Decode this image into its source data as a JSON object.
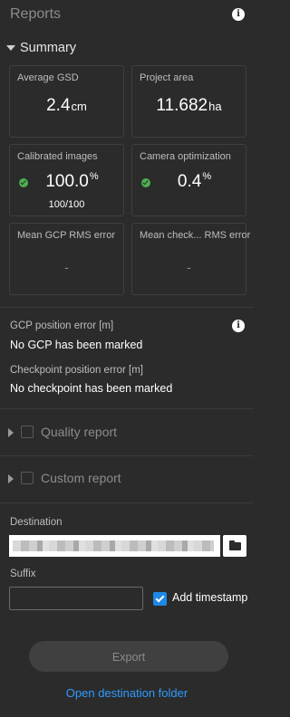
{
  "header": {
    "title": "Reports"
  },
  "summary": {
    "label": "Summary",
    "cards": [
      {
        "label": "Average GSD",
        "value": "2.4",
        "unit": "cm"
      },
      {
        "label": "Project area",
        "value": "11.682",
        "unit": "ha"
      },
      {
        "label": "Calibrated images",
        "value": "100.0",
        "unit": "%",
        "sub": "100/100",
        "status": "ok"
      },
      {
        "label": "Camera optimization",
        "value": "0.4",
        "unit": "%",
        "status": "ok"
      },
      {
        "label": "Mean GCP RMS error",
        "value": "-"
      },
      {
        "label": "Mean check... RMS error",
        "value": "-"
      }
    ]
  },
  "errors": {
    "gcp_label": "GCP position error [m]",
    "gcp_value": "No GCP has been marked",
    "checkpoint_label": "Checkpoint position error [m]",
    "checkpoint_value": "No checkpoint has been marked"
  },
  "quality_report": {
    "label": "Quality report",
    "checked": false
  },
  "custom_report": {
    "label": "Custom report",
    "checked": false
  },
  "destination": {
    "label": "Destination"
  },
  "suffix": {
    "label": "Suffix",
    "value": ""
  },
  "timestamp": {
    "label": "Add timestamp",
    "checked": true
  },
  "export_label": "Export",
  "open_folder_label": "Open destination folder",
  "colors": {
    "accent": "#1e88e5",
    "link": "#2f9bff",
    "ok": "#4caf50"
  }
}
